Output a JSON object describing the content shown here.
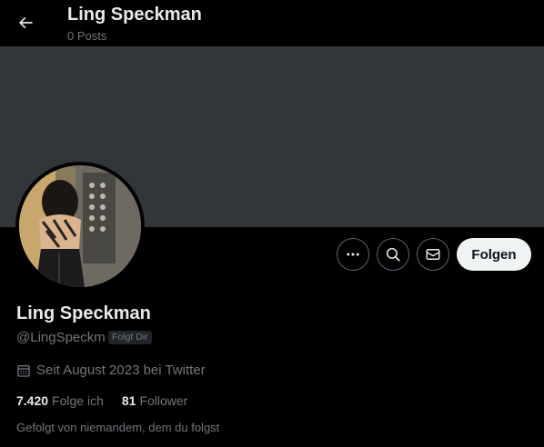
{
  "header": {
    "title": "Ling Speckman",
    "subtitle": "0 Posts",
    "back_icon": "arrow-left-icon"
  },
  "profile": {
    "display_name": "Ling Speckman",
    "handle": "@LingSpeckm",
    "follows_you_badge": "Folgt Dir",
    "joined": "Seit August 2023 bei Twitter",
    "following_count": "7.420",
    "following_label": "Folge ich",
    "followers_count": "81",
    "followers_label": "Follower",
    "followed_by": "Gefolgt von niemandem, dem du folgst"
  },
  "actions": {
    "more_icon": "more-horizontal-icon",
    "search_icon": "search-icon",
    "message_icon": "envelope-icon",
    "follow_label": "Folgen"
  },
  "colors": {
    "background": "#000000",
    "banner": "#333639",
    "primary_text": "#e7e9ea",
    "secondary_text": "#71767b",
    "button_bg": "#eff3f4"
  }
}
